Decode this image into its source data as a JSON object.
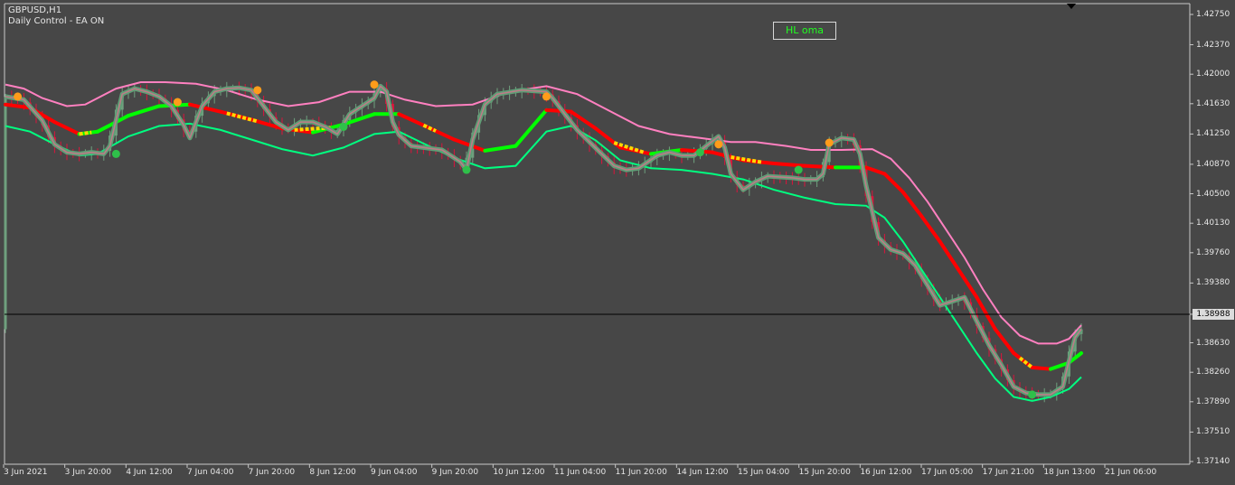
{
  "header": {
    "symbol": "GBPUSD,H1",
    "ea_status": "Daily Control - EA ON"
  },
  "hl_button": {
    "label": "HL oma"
  },
  "colors": {
    "background": "#474747",
    "bull_candle": "#6fa07e",
    "bear_candle": "#dc143c",
    "upper_band": "#ff80c0",
    "lower_band": "#00ff80",
    "mid_line_down": "#ff0000",
    "mid_line_up": "#00ff00",
    "flat_marker": "#ffd700",
    "oma_line": "#5f9e76",
    "swing_high_dot": "#ff9c1a",
    "swing_low_dot": "#2fc04a",
    "bid_line": "#000000"
  },
  "chart_data": {
    "type": "line",
    "title": "GBPUSD,H1",
    "ylim": [
      1.3714,
      1.4275
    ],
    "y_ticks": [
      "1.42750",
      "1.42370",
      "1.42000",
      "1.41630",
      "1.41250",
      "1.40870",
      "1.40500",
      "1.40130",
      "1.39760",
      "1.39380",
      "1.38988",
      "1.38630",
      "1.38260",
      "1.37890",
      "1.37510",
      "1.37140"
    ],
    "current_price": "1.38988",
    "x_ticks": [
      "3 Jun 2021",
      "3 Jun 20:00",
      "4 Jun 12:00",
      "7 Jun 04:00",
      "7 Jun 20:00",
      "8 Jun 12:00",
      "9 Jun 04:00",
      "9 Jun 20:00",
      "10 Jun 12:00",
      "11 Jun 04:00",
      "11 Jun 20:00",
      "14 Jun 12:00",
      "15 Jun 04:00",
      "15 Jun 20:00",
      "16 Jun 12:00",
      "17 Jun 05:00",
      "17 Jun 21:00",
      "18 Jun 13:00",
      "21 Jun 06:00"
    ],
    "series": [
      {
        "key": "upper",
        "values": [
          [
            0,
            1.4187
          ],
          [
            3,
            1.4182
          ],
          [
            6,
            1.417
          ],
          [
            10,
            1.416
          ],
          [
            13,
            1.4162
          ],
          [
            18,
            1.4182
          ],
          [
            22,
            1.419
          ],
          [
            26,
            1.419
          ],
          [
            31,
            1.4188
          ],
          [
            36,
            1.418
          ],
          [
            41,
            1.4168
          ],
          [
            46,
            1.416
          ],
          [
            51,
            1.4165
          ],
          [
            56,
            1.4178
          ],
          [
            61,
            1.4178
          ],
          [
            65,
            1.4168
          ],
          [
            70,
            1.416
          ],
          [
            76,
            1.4162
          ],
          [
            82,
            1.4178
          ],
          [
            88,
            1.4185
          ],
          [
            93,
            1.4175
          ],
          [
            98,
            1.4155
          ],
          [
            103,
            1.4135
          ],
          [
            108,
            1.4125
          ],
          [
            113,
            1.412
          ],
          [
            118,
            1.4115
          ],
          [
            122,
            1.4115
          ],
          [
            127,
            1.411
          ],
          [
            131,
            1.4105
          ],
          [
            136,
            1.4105
          ],
          [
            141,
            1.4106
          ],
          [
            144,
            1.4094
          ],
          [
            147,
            1.407
          ],
          [
            150,
            1.404
          ],
          [
            153,
            1.4005
          ],
          [
            156,
            1.397
          ],
          [
            159,
            1.393
          ],
          [
            162,
            1.3895
          ],
          [
            165,
            1.3872
          ],
          [
            168,
            1.3862
          ],
          [
            171,
            1.3862
          ],
          [
            173,
            1.3868
          ],
          [
            175,
            1.3885
          ]
        ]
      },
      {
        "key": "mid",
        "values": [
          [
            0,
            1.4162
          ],
          [
            4,
            1.4158
          ],
          [
            8,
            1.414
          ],
          [
            12,
            1.4125
          ],
          [
            15,
            1.4128
          ],
          [
            20,
            1.4148
          ],
          [
            25,
            1.416
          ],
          [
            30,
            1.4162
          ],
          [
            35,
            1.4153
          ],
          [
            40,
            1.4143
          ],
          [
            45,
            1.4132
          ],
          [
            50,
            1.4127
          ],
          [
            55,
            1.4137
          ],
          [
            60,
            1.415
          ],
          [
            64,
            1.415
          ],
          [
            68,
            1.4136
          ],
          [
            73,
            1.4118
          ],
          [
            78,
            1.4104
          ],
          [
            83,
            1.411
          ],
          [
            88,
            1.4155
          ],
          [
            92,
            1.4153
          ],
          [
            96,
            1.4132
          ],
          [
            100,
            1.4108
          ],
          [
            105,
            1.41
          ],
          [
            110,
            1.4105
          ],
          [
            115,
            1.4102
          ],
          [
            120,
            1.4092
          ],
          [
            125,
            1.4088
          ],
          [
            130,
            1.4085
          ],
          [
            135,
            1.4083
          ],
          [
            140,
            1.4083
          ],
          [
            143,
            1.4075
          ],
          [
            146,
            1.4052
          ],
          [
            149,
            1.4022
          ],
          [
            152,
            1.399
          ],
          [
            155,
            1.3955
          ],
          [
            158,
            1.392
          ],
          [
            161,
            1.388
          ],
          [
            164,
            1.385
          ],
          [
            167,
            1.3832
          ],
          [
            170,
            1.383
          ],
          [
            173,
            1.3838
          ],
          [
            175,
            1.385
          ]
        ]
      },
      {
        "key": "lower",
        "values": [
          [
            0,
            1.4135
          ],
          [
            4,
            1.4128
          ],
          [
            8,
            1.4112
          ],
          [
            12,
            1.4098
          ],
          [
            15,
            1.41
          ],
          [
            20,
            1.4122
          ],
          [
            25,
            1.4135
          ],
          [
            30,
            1.4138
          ],
          [
            35,
            1.413
          ],
          [
            40,
            1.4118
          ],
          [
            45,
            1.4106
          ],
          [
            50,
            1.4098
          ],
          [
            55,
            1.4108
          ],
          [
            60,
            1.4125
          ],
          [
            64,
            1.4128
          ],
          [
            68,
            1.4113
          ],
          [
            73,
            1.4095
          ],
          [
            78,
            1.4082
          ],
          [
            83,
            1.4085
          ],
          [
            88,
            1.4128
          ],
          [
            92,
            1.4135
          ],
          [
            96,
            1.4117
          ],
          [
            100,
            1.4092
          ],
          [
            105,
            1.4082
          ],
          [
            110,
            1.408
          ],
          [
            115,
            1.4075
          ],
          [
            120,
            1.4068
          ],
          [
            125,
            1.4055
          ],
          [
            130,
            1.4045
          ],
          [
            135,
            1.4037
          ],
          [
            140,
            1.4035
          ],
          [
            143,
            1.402
          ],
          [
            146,
            1.399
          ],
          [
            149,
            1.3955
          ],
          [
            152,
            1.392
          ],
          [
            155,
            1.3885
          ],
          [
            158,
            1.385
          ],
          [
            161,
            1.3818
          ],
          [
            164,
            1.3795
          ],
          [
            167,
            1.379
          ],
          [
            170,
            1.3795
          ],
          [
            173,
            1.3805
          ],
          [
            175,
            1.382
          ]
        ]
      },
      {
        "key": "oma",
        "values": [
          [
            0,
            1.4172
          ],
          [
            3,
            1.4168
          ],
          [
            6,
            1.4142
          ],
          [
            8,
            1.4112
          ],
          [
            10,
            1.4102
          ],
          [
            12,
            1.41
          ],
          [
            14,
            1.4102
          ],
          [
            16,
            1.41
          ],
          [
            17,
            1.411
          ],
          [
            19,
            1.4175
          ],
          [
            21,
            1.4182
          ],
          [
            23,
            1.4178
          ],
          [
            25,
            1.4172
          ],
          [
            27,
            1.416
          ],
          [
            29,
            1.4136
          ],
          [
            30,
            1.412
          ],
          [
            32,
            1.416
          ],
          [
            34,
            1.4178
          ],
          [
            36,
            1.4182
          ],
          [
            38,
            1.4183
          ],
          [
            40,
            1.418
          ],
          [
            42,
            1.416
          ],
          [
            44,
            1.414
          ],
          [
            46,
            1.413
          ],
          [
            48,
            1.414
          ],
          [
            50,
            1.414
          ],
          [
            52,
            1.4134
          ],
          [
            54,
            1.4125
          ],
          [
            56,
            1.415
          ],
          [
            58,
            1.416
          ],
          [
            60,
            1.417
          ],
          [
            61,
            1.4185
          ],
          [
            62,
            1.4178
          ],
          [
            63,
            1.414
          ],
          [
            64,
            1.4124
          ],
          [
            66,
            1.411
          ],
          [
            68,
            1.4108
          ],
          [
            71,
            1.4105
          ],
          [
            73,
            1.4095
          ],
          [
            74,
            1.409
          ],
          [
            75,
            1.408
          ],
          [
            76,
            1.4118
          ],
          [
            78,
            1.4162
          ],
          [
            80,
            1.4175
          ],
          [
            84,
            1.418
          ],
          [
            88,
            1.4178
          ],
          [
            89,
            1.417
          ],
          [
            91,
            1.415
          ],
          [
            93,
            1.413
          ],
          [
            95,
            1.4115
          ],
          [
            97,
            1.41
          ],
          [
            99,
            1.4085
          ],
          [
            101,
            1.408
          ],
          [
            103,
            1.4082
          ],
          [
            106,
            1.4098
          ],
          [
            108,
            1.4102
          ],
          [
            110,
            1.4098
          ],
          [
            112,
            1.4098
          ],
          [
            114,
            1.411
          ],
          [
            116,
            1.4122
          ],
          [
            117,
            1.4108
          ],
          [
            118,
            1.4075
          ],
          [
            120,
            1.4055
          ],
          [
            122,
            1.4065
          ],
          [
            124,
            1.4072
          ],
          [
            128,
            1.407
          ],
          [
            130,
            1.4068
          ],
          [
            132,
            1.4068
          ],
          [
            133,
            1.4075
          ],
          [
            134,
            1.4112
          ],
          [
            136,
            1.412
          ],
          [
            138,
            1.4118
          ],
          [
            139,
            1.41
          ],
          [
            140,
            1.406
          ],
          [
            142,
            1.3995
          ],
          [
            144,
            1.398
          ],
          [
            146,
            1.3975
          ],
          [
            148,
            1.396
          ],
          [
            150,
            1.3935
          ],
          [
            152,
            1.391
          ],
          [
            154,
            1.3915
          ],
          [
            156,
            1.392
          ],
          [
            158,
            1.389
          ],
          [
            160,
            1.386
          ],
          [
            162,
            1.3835
          ],
          [
            164,
            1.3808
          ],
          [
            166,
            1.38
          ],
          [
            168,
            1.3798
          ],
          [
            170,
            1.3798
          ],
          [
            172,
            1.3808
          ],
          [
            173,
            1.384
          ],
          [
            174,
            1.387
          ],
          [
            175,
            1.388
          ]
        ]
      }
    ],
    "flat_segments": [
      [
        12,
        14
      ],
      [
        36,
        41
      ],
      [
        47,
        53
      ],
      [
        68,
        70
      ],
      [
        99,
        104
      ],
      [
        118,
        123
      ],
      [
        165,
        167
      ]
    ],
    "swing_highs": [
      [
        2,
        1.4172
      ],
      [
        28,
        1.4165
      ],
      [
        41,
        1.418
      ],
      [
        60,
        1.4187
      ],
      [
        88,
        1.4172
      ],
      [
        116,
        1.4112
      ],
      [
        134,
        1.4114
      ]
    ],
    "swing_lows": [
      [
        18,
        1.41
      ],
      [
        55,
        1.4134
      ],
      [
        75,
        1.408
      ],
      [
        113,
        1.4102
      ],
      [
        129,
        1.408
      ],
      [
        167,
        1.3798
      ]
    ]
  }
}
